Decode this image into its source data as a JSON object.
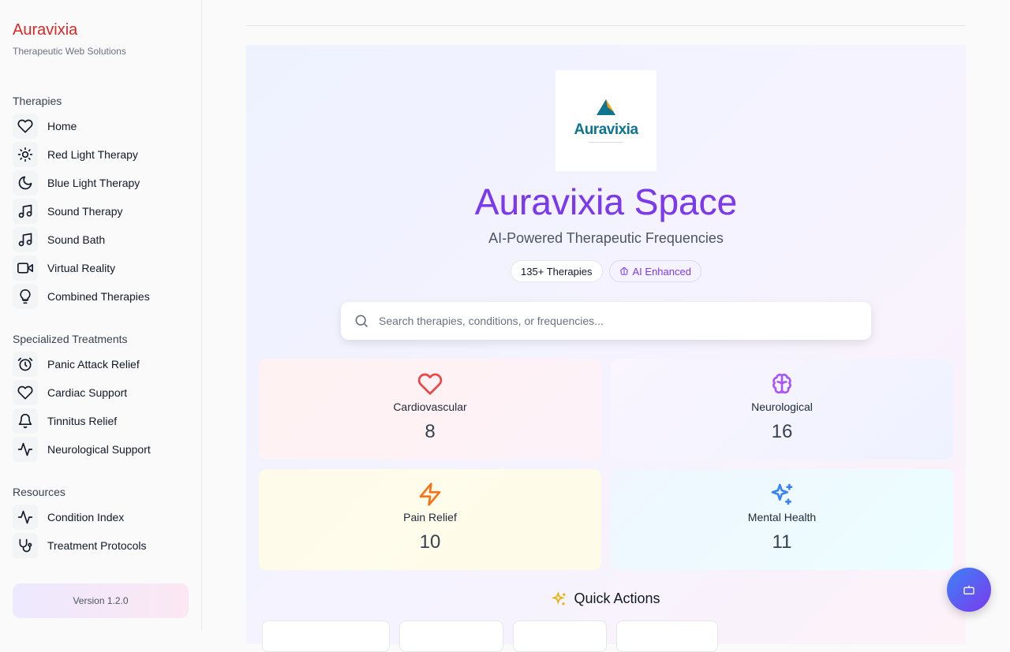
{
  "brand": {
    "title": "Auravixia",
    "subtitle": "Therapeutic Web Solutions"
  },
  "sidebar": {
    "groups": [
      {
        "label": "Therapies",
        "items": [
          {
            "label": "Home",
            "icon": "heart-icon"
          },
          {
            "label": "Red Light Therapy",
            "icon": "sun-icon"
          },
          {
            "label": "Blue Light Therapy",
            "icon": "moon-icon"
          },
          {
            "label": "Sound Therapy",
            "icon": "music-icon"
          },
          {
            "label": "Sound Bath",
            "icon": "music-icon"
          },
          {
            "label": "Virtual Reality",
            "icon": "video-icon"
          },
          {
            "label": "Combined Therapies",
            "icon": "lightbulb-icon"
          }
        ]
      },
      {
        "label": "Specialized Treatments",
        "items": [
          {
            "label": "Panic Attack Relief",
            "icon": "alarm-clock-icon"
          },
          {
            "label": "Cardiac Support",
            "icon": "heart-icon"
          },
          {
            "label": "Tinnitus Relief",
            "icon": "bell-icon"
          },
          {
            "label": "Neurological Support",
            "icon": "activity-icon"
          }
        ]
      },
      {
        "label": "Resources",
        "items": [
          {
            "label": "Condition Index",
            "icon": "activity-icon"
          },
          {
            "label": "Treatment Protocols",
            "icon": "stethoscope-icon"
          }
        ]
      }
    ],
    "version": "Version 1.2.0"
  },
  "hero": {
    "logo_text": "Auravixia",
    "title": "Auravixia Space",
    "subtitle": "AI-Powered Therapeutic Frequencies",
    "badge_count": "135+ Therapies",
    "badge_ai": "AI Enhanced",
    "search_placeholder": "Search therapies, conditions, or frequencies..."
  },
  "categories": [
    {
      "label": "Cardiovascular",
      "count": "8",
      "icon": "heart-icon",
      "color": "#ef4444"
    },
    {
      "label": "Neurological",
      "count": "16",
      "icon": "brain-icon",
      "color": "#a855f7"
    },
    {
      "label": "Pain Relief",
      "count": "10",
      "icon": "zap-icon",
      "color": "#f97316"
    },
    {
      "label": "Mental Health",
      "count": "11",
      "icon": "sparkles-icon",
      "color": "#3b82f6"
    }
  ],
  "quick_actions": {
    "title": "Quick Actions"
  },
  "colors": {
    "brand": "#dc2626",
    "accent": "#7c3aed"
  }
}
